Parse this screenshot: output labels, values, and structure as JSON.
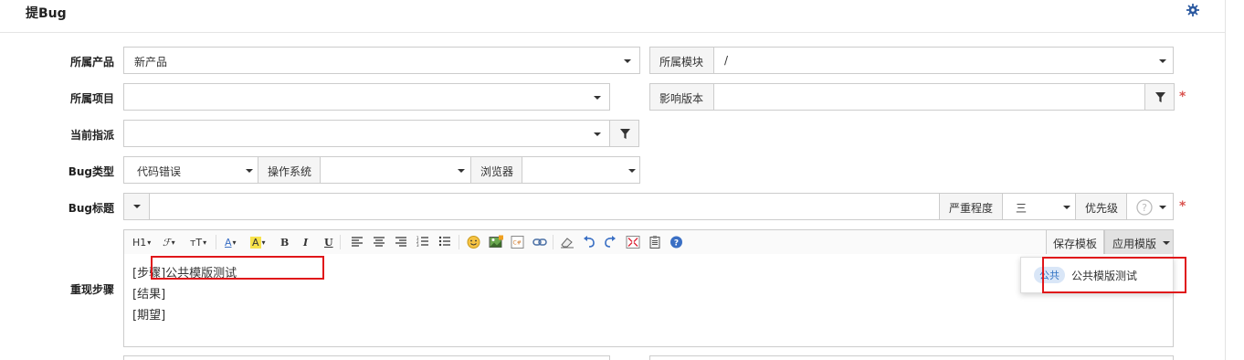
{
  "header": {
    "title": "提Bug",
    "settings_icon": "gear-icon"
  },
  "product": {
    "label": "所属产品",
    "value": "新产品"
  },
  "module": {
    "label": "所属模块",
    "value": "/"
  },
  "project": {
    "label": "所属项目",
    "value": ""
  },
  "build": {
    "label": "影响版本",
    "value": ""
  },
  "assign": {
    "label": "当前指派",
    "value": ""
  },
  "bugtype": {
    "label": "Bug类型",
    "value": "代码错误"
  },
  "os": {
    "label": "操作系统",
    "value": ""
  },
  "browser": {
    "label": "浏览器",
    "value": ""
  },
  "bugtitle": {
    "label": "Bug标题",
    "value": ""
  },
  "severity": {
    "label": "严重程度",
    "value": "三"
  },
  "priority": {
    "label": "优先级",
    "value": "?"
  },
  "steps": {
    "label": "重现步骤",
    "lines": [
      "[步骤]公共模版测试",
      "[结果]",
      "[期望]"
    ],
    "save_template": "保存模板",
    "apply_template": "应用模版",
    "template_menu": {
      "badge": "公共",
      "item": "公共模版测试"
    }
  },
  "toolbar": {
    "heading": "H1",
    "font": "ℱ",
    "size": "тT",
    "color_a": "A",
    "highlight_a": "A",
    "bold": "B",
    "italic": "I",
    "underline": "U"
  },
  "colors": {
    "required": "#d9534f",
    "highlight": "#e0161a",
    "badge_bg": "#d9e6f7"
  }
}
